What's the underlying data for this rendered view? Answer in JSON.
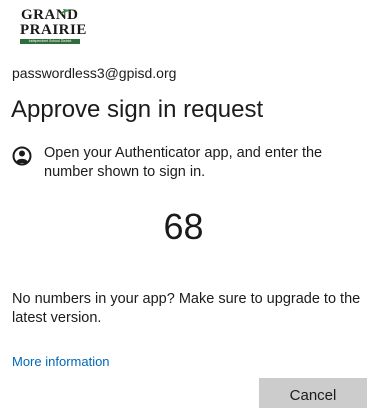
{
  "logo": {
    "line1": "GRAND",
    "line2": "PRAIRIE",
    "tagline": "Independent School District"
  },
  "account": {
    "email": "passwordless3@gpisd.org"
  },
  "heading": {
    "title": "Approve sign in request"
  },
  "instruction": {
    "icon": "authenticator-lock-icon",
    "text": "Open your Authenticator app, and enter the number shown to sign in."
  },
  "code": {
    "number": "68"
  },
  "help": {
    "upgrade_text": "No numbers in your app? Make sure to upgrade to the latest version.",
    "more_info_label": "More information"
  },
  "actions": {
    "cancel_label": "Cancel"
  },
  "colors": {
    "link": "#0067b8",
    "button_bg": "#cccccc",
    "text": "#1b1b1b"
  }
}
